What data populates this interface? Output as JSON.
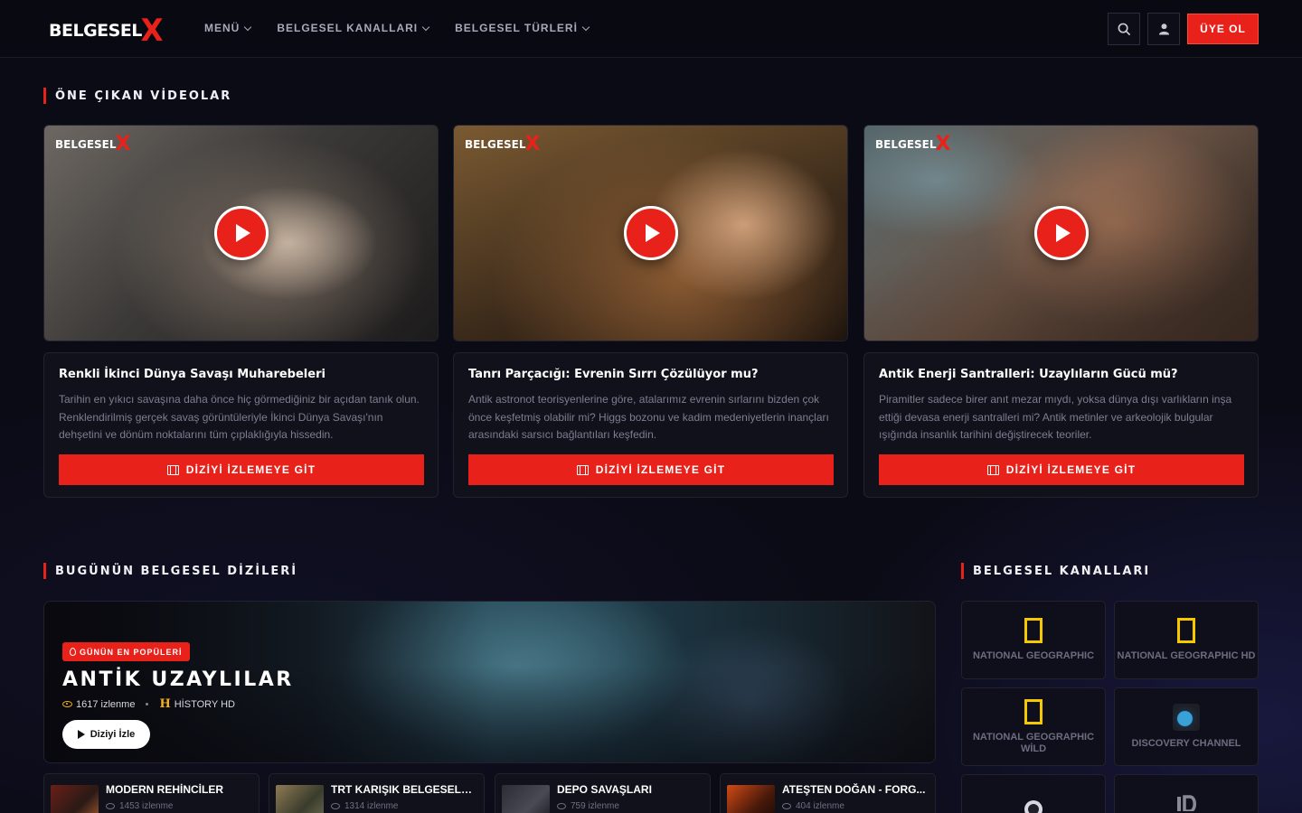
{
  "header": {
    "logo_text": "BELGESEL",
    "logo_x": "X",
    "nav": [
      {
        "label": "MENÜ"
      },
      {
        "label": "BELGESEL KANALLARI"
      },
      {
        "label": "BELGESEL TÜRLERİ"
      }
    ],
    "signup_label": "ÜYE OL"
  },
  "featured": {
    "section_title": "ÖNE ÇIKAN VİDEOLAR",
    "thumb_logo_text": "BELGESEL",
    "thumb_logo_x": "X",
    "button_label": "DİZİYİ İZLEMEYE GİT",
    "cards": [
      {
        "title": "Renkli İkinci Dünya Savaşı Muharebeleri",
        "description": "Tarihin en yıkıcı savaşına daha önce hiç görmediğiniz bir açıdan tanık olun. Renklendirilmiş gerçek savaş görüntüleriyle İkinci Dünya Savaşı'nın dehşetini ve dönüm noktalarını tüm çıplaklığıyla hissedin."
      },
      {
        "title": "Tanrı Parçacığı: Evrenin Sırrı Çözülüyor mu?",
        "description": "Antik astronot teorisyenlerine göre, atalarımız evrenin sırlarını bizden çok önce keşfetmiş olabilir mi? Higgs bozonu ve kadim medeniyetlerin inançları arasındaki sarsıcı bağlantıları keşfedin."
      },
      {
        "title": "Antik Enerji Santralleri: Uzaylıların Gücü mü?",
        "description": "Piramitler sadece birer anıt mezar mıydı, yoksa dünya dışı varlıkların inşa ettiği devasa enerji santralleri mi? Antik metinler ve arkeolojik bulgular ışığında insanlık tarihini değiştirecek teoriler."
      }
    ]
  },
  "today": {
    "section_title": "BUGÜNÜN BELGESEL DİZİLERİ",
    "hero": {
      "badge": "GÜNÜN EN POPÜLERİ",
      "title": "ANTİK UZAYLILAR",
      "views": "1617 izlenme",
      "channel": "HİSTORY HD",
      "button_label": "Diziyi İzle"
    },
    "series": [
      {
        "title": "MODERN REHİNCİLER",
        "views": "1453 izlenme"
      },
      {
        "title": "TRT KARIŞIK BELGESELLER",
        "views": "1314 izlenme"
      },
      {
        "title": "DEPO SAVAŞLARI",
        "views": "759 izlenme"
      },
      {
        "title": "ATEŞTEN DOĞAN - FORG...",
        "views": "404 izlenme"
      }
    ]
  },
  "channels": {
    "section_title": "BELGESEL KANALLARI",
    "items": [
      {
        "name": "NATIONAL GEOGRAPHIC",
        "icon": "national-geographic-icon"
      },
      {
        "name": "NATIONAL GEOGRAPHIC HD",
        "icon": "national-geographic-icon"
      },
      {
        "name": "NATIONAL GEOGRAPHIC WİLD",
        "icon": "national-geographic-icon"
      },
      {
        "name": "DISCOVERY CHANNEL",
        "icon": "discovery-icon"
      }
    ]
  },
  "colors": {
    "accent": "#e8221b",
    "background": "#0b0b16",
    "ng_yellow": "#f5c800",
    "views_icon": "#f5b21a"
  }
}
